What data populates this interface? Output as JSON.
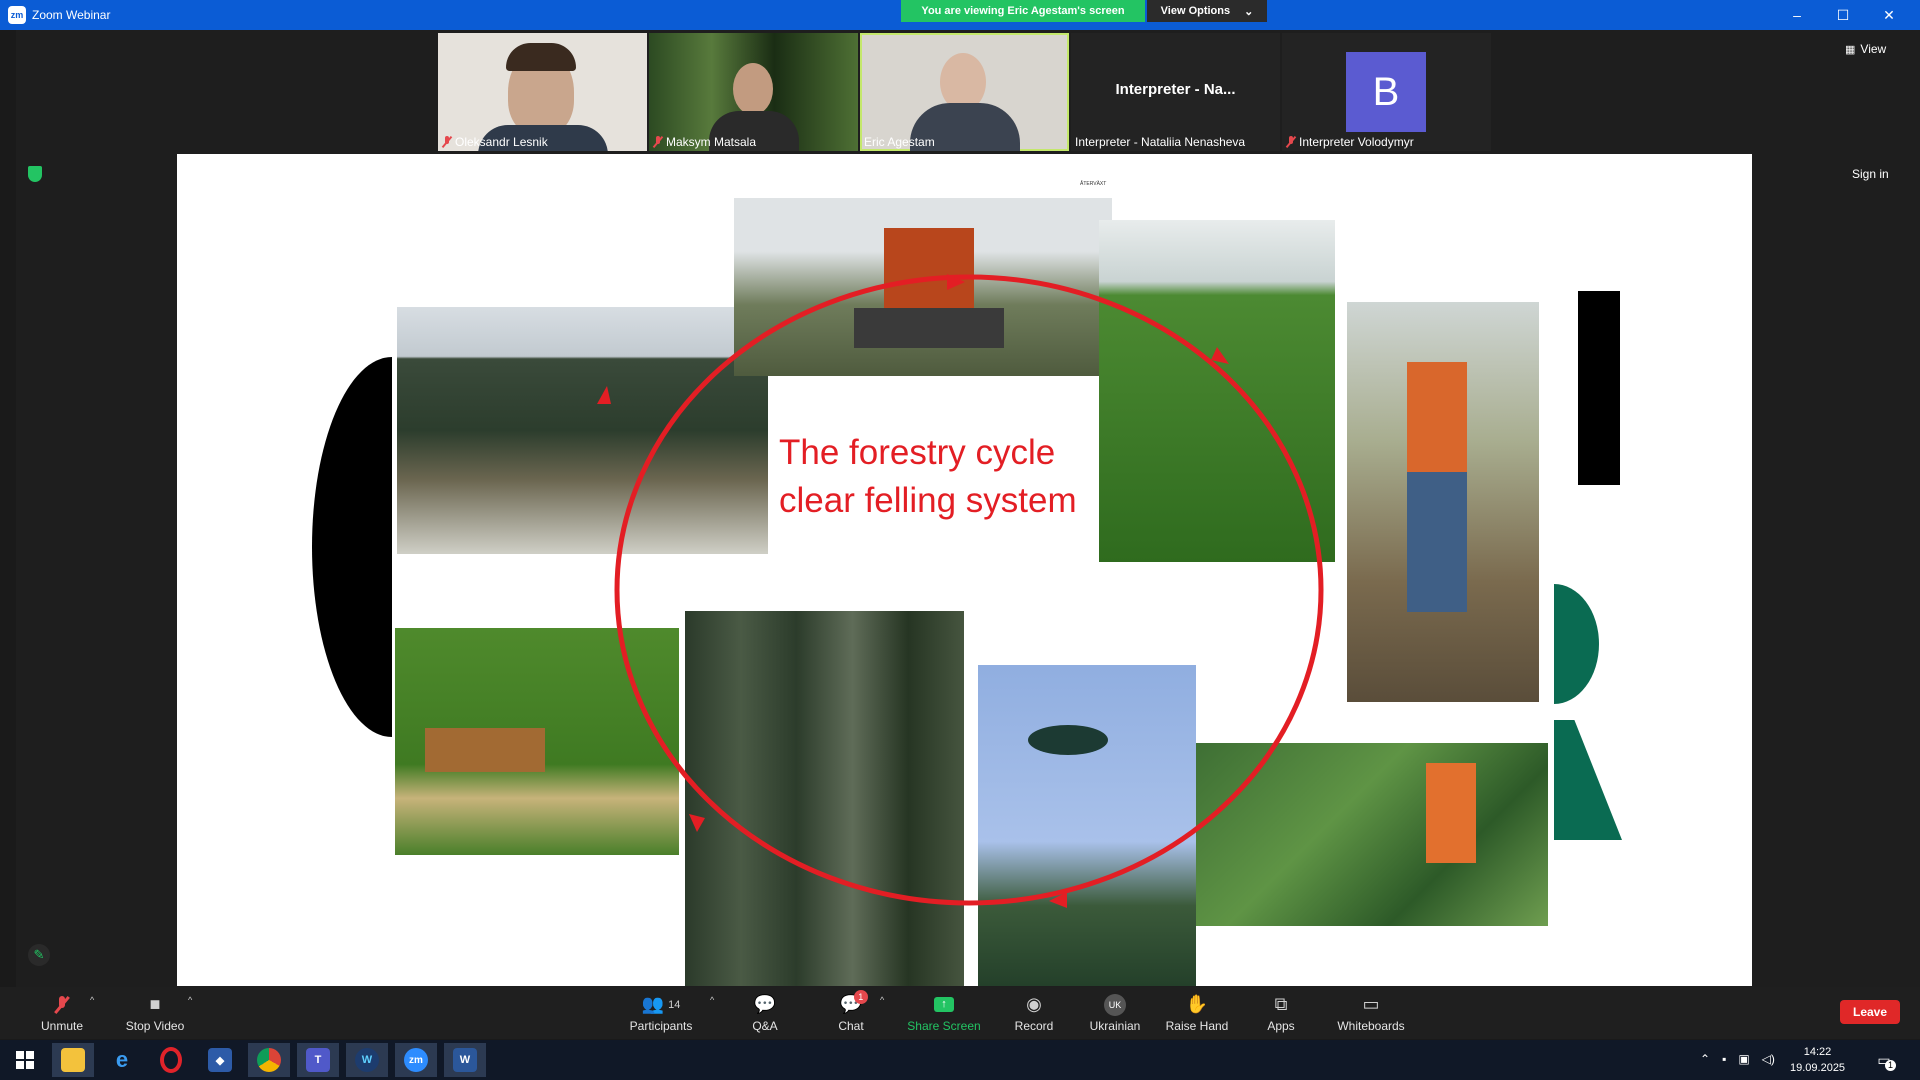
{
  "window": {
    "app_logo": "zm",
    "title": "Zoom Webinar"
  },
  "banner": {
    "viewing_text": "You are viewing Eric Agestam's screen",
    "view_options": "View Options",
    "chevron": "⌄"
  },
  "window_controls": {
    "minimize": "–",
    "maximize": "☐",
    "close": "✕"
  },
  "gallery": {
    "participants": [
      {
        "name": "Oleksandr Lesnik",
        "muted": true
      },
      {
        "name": "Maksym Matsala",
        "muted": true
      },
      {
        "name": "Eric Agestam",
        "muted": false,
        "active_speaker": true
      },
      {
        "name": "Interpreter - Nataliia Nenasheva",
        "muted": false,
        "display_name": "Interpreter - Na..."
      },
      {
        "name": "Interpreter Volodymyr",
        "muted": true,
        "avatar_letter": "B"
      }
    ]
  },
  "top_right": {
    "view_label": "View",
    "sign_in": "Sign in"
  },
  "slide": {
    "line1": "The forestry cycle",
    "line2": "clear felling system",
    "tiny_label": "ÅTERVÄXT"
  },
  "toolbar": {
    "unmute": "Unmute",
    "stop_video": "Stop Video",
    "participants": "Participants",
    "participants_count": "14",
    "qa": "Q&A",
    "chat": "Chat",
    "chat_badge": "1",
    "share_screen": "Share Screen",
    "record": "Record",
    "language_code": "UK",
    "language": "Ukrainian",
    "raise_hand": "Raise Hand",
    "apps": "Apps",
    "whiteboards": "Whiteboards",
    "leave": "Leave",
    "caret": "^"
  },
  "taskbar": {
    "time": "14:22",
    "date": "19.09.2025",
    "notif_count": "1"
  },
  "colors": {
    "zoom_blue": "#0b5cd5",
    "green": "#23c463",
    "red": "#e31e24",
    "leave_red": "#e02828"
  }
}
